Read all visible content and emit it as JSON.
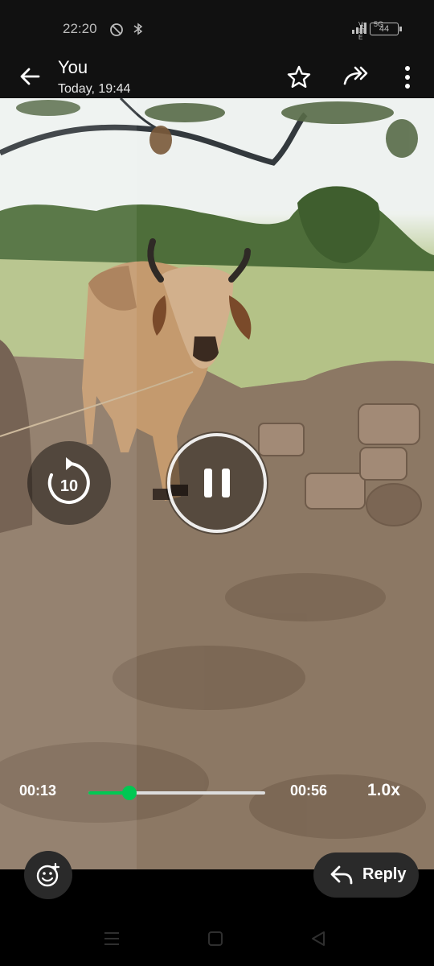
{
  "status_bar": {
    "time": "22:20",
    "network_label": "Vo LTE",
    "network_type": "5G",
    "battery": "44",
    "icons": [
      "do-not-disturb-icon",
      "bluetooth-icon",
      "signal-icon",
      "battery-icon"
    ]
  },
  "header": {
    "title": "You",
    "subtitle": "Today, 19:44",
    "icons": [
      "back-arrow-icon",
      "star-icon",
      "forward-icon",
      "more-vert-icon"
    ]
  },
  "player": {
    "current_time": "00:13",
    "duration": "00:56",
    "speed": "1.0x",
    "progress": 0.232,
    "seek_back_seconds": "10",
    "state": "playing",
    "accent_color": "#00c853"
  },
  "footer": {
    "reply_label": "Reply",
    "icons": [
      "emoji-add-icon",
      "reply-icon"
    ]
  },
  "navigation_bar": {
    "icons": [
      "recents-icon",
      "home-icon",
      "back-icon"
    ]
  }
}
